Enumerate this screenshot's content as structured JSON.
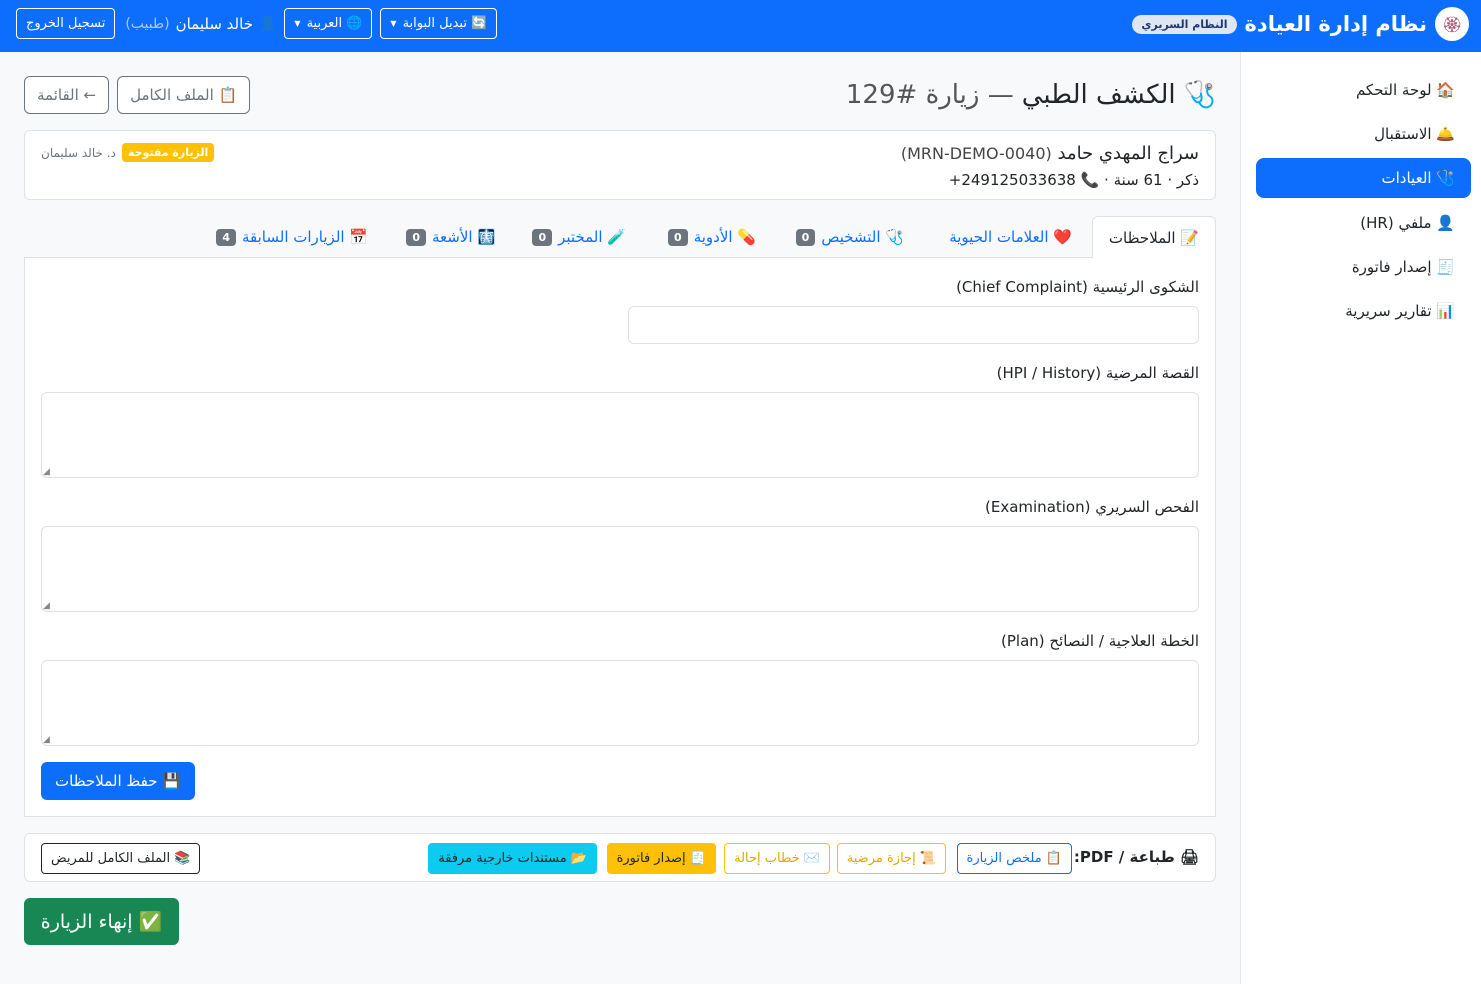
{
  "navbar": {
    "logo_icon": "🏵",
    "brand_title": "نظام إدارة العيادة",
    "brand_badge": "النظام السريري",
    "switch_portal": "🔄 تبديل البوابة",
    "language": "🌐 العربية",
    "user_icon": "👤",
    "user_name": "خالد سليمان",
    "user_role": "(طبيب)",
    "logout": "تسجيل الخروج"
  },
  "sidebar": {
    "items": [
      {
        "label": "🏠 لوحة التحكم"
      },
      {
        "label": "🛎️ الاستقبال"
      },
      {
        "label": "🩺 العيادات"
      },
      {
        "label": "👤 ملفي (HR)"
      },
      {
        "label": "🧾 إصدار فاتورة"
      },
      {
        "label": "📊 تقارير سريرية"
      }
    ]
  },
  "header": {
    "title_icon": "🩺",
    "title": "الكشف الطبي",
    "visit": "— زيارة #129",
    "full_file_button": "📋 الملف الكامل",
    "list_button": "← القائمة"
  },
  "patient": {
    "name": "سراج المهدي حامد",
    "mrn": "(MRN-DEMO-0040)",
    "info": "ذكر · 61 سنة · 📞 249125033638+",
    "doctor": "د. خالد سليمان",
    "status": "الزيارة مفتوحة"
  },
  "tabs": [
    {
      "label": "📝 الملاحظات"
    },
    {
      "label": "❤️ العلامات الحيوية"
    },
    {
      "label": "🩺 التشخيص",
      "count": "0"
    },
    {
      "label": "💊 الأدوية",
      "count": "0"
    },
    {
      "label": "🧪 المختبر",
      "count": "0"
    },
    {
      "label": "🩻 الأشعة",
      "count": "0"
    },
    {
      "label": "📅 الزيارات السابقة",
      "count": "4"
    }
  ],
  "notes_form": {
    "chief_complaint_label": "الشكوى الرئيسية (Chief Complaint)",
    "chief_complaint_value": "",
    "history_label": "القصة المرضية (HPI / History)",
    "history_value": "",
    "exam_label": "الفحص السريري (Examination)",
    "exam_value": "",
    "plan_label": "الخطة العلاجية / النصائح (Plan)",
    "plan_value": "",
    "save_button": "💾 حفظ الملاحظات"
  },
  "print_bar": {
    "title": "🖨 طباعة / PDF:",
    "visit_summary": "📋 ملخص الزيارة",
    "sick_leave": "📜 إجازة مرضية",
    "referral": "✉️ خطاب إحالة",
    "invoice": "🧾 إصدار فاتورة",
    "attachments": "📂 مستندات خارجية مرفقة",
    "full_record": "📚 الملف الكامل للمريض"
  },
  "end_visit_button": "✅ إنهاء الزيارة",
  "colors": {
    "primary": "#0d6efd",
    "success": "#198754",
    "warning": "#ffc107",
    "info": "#0dcaf0"
  }
}
